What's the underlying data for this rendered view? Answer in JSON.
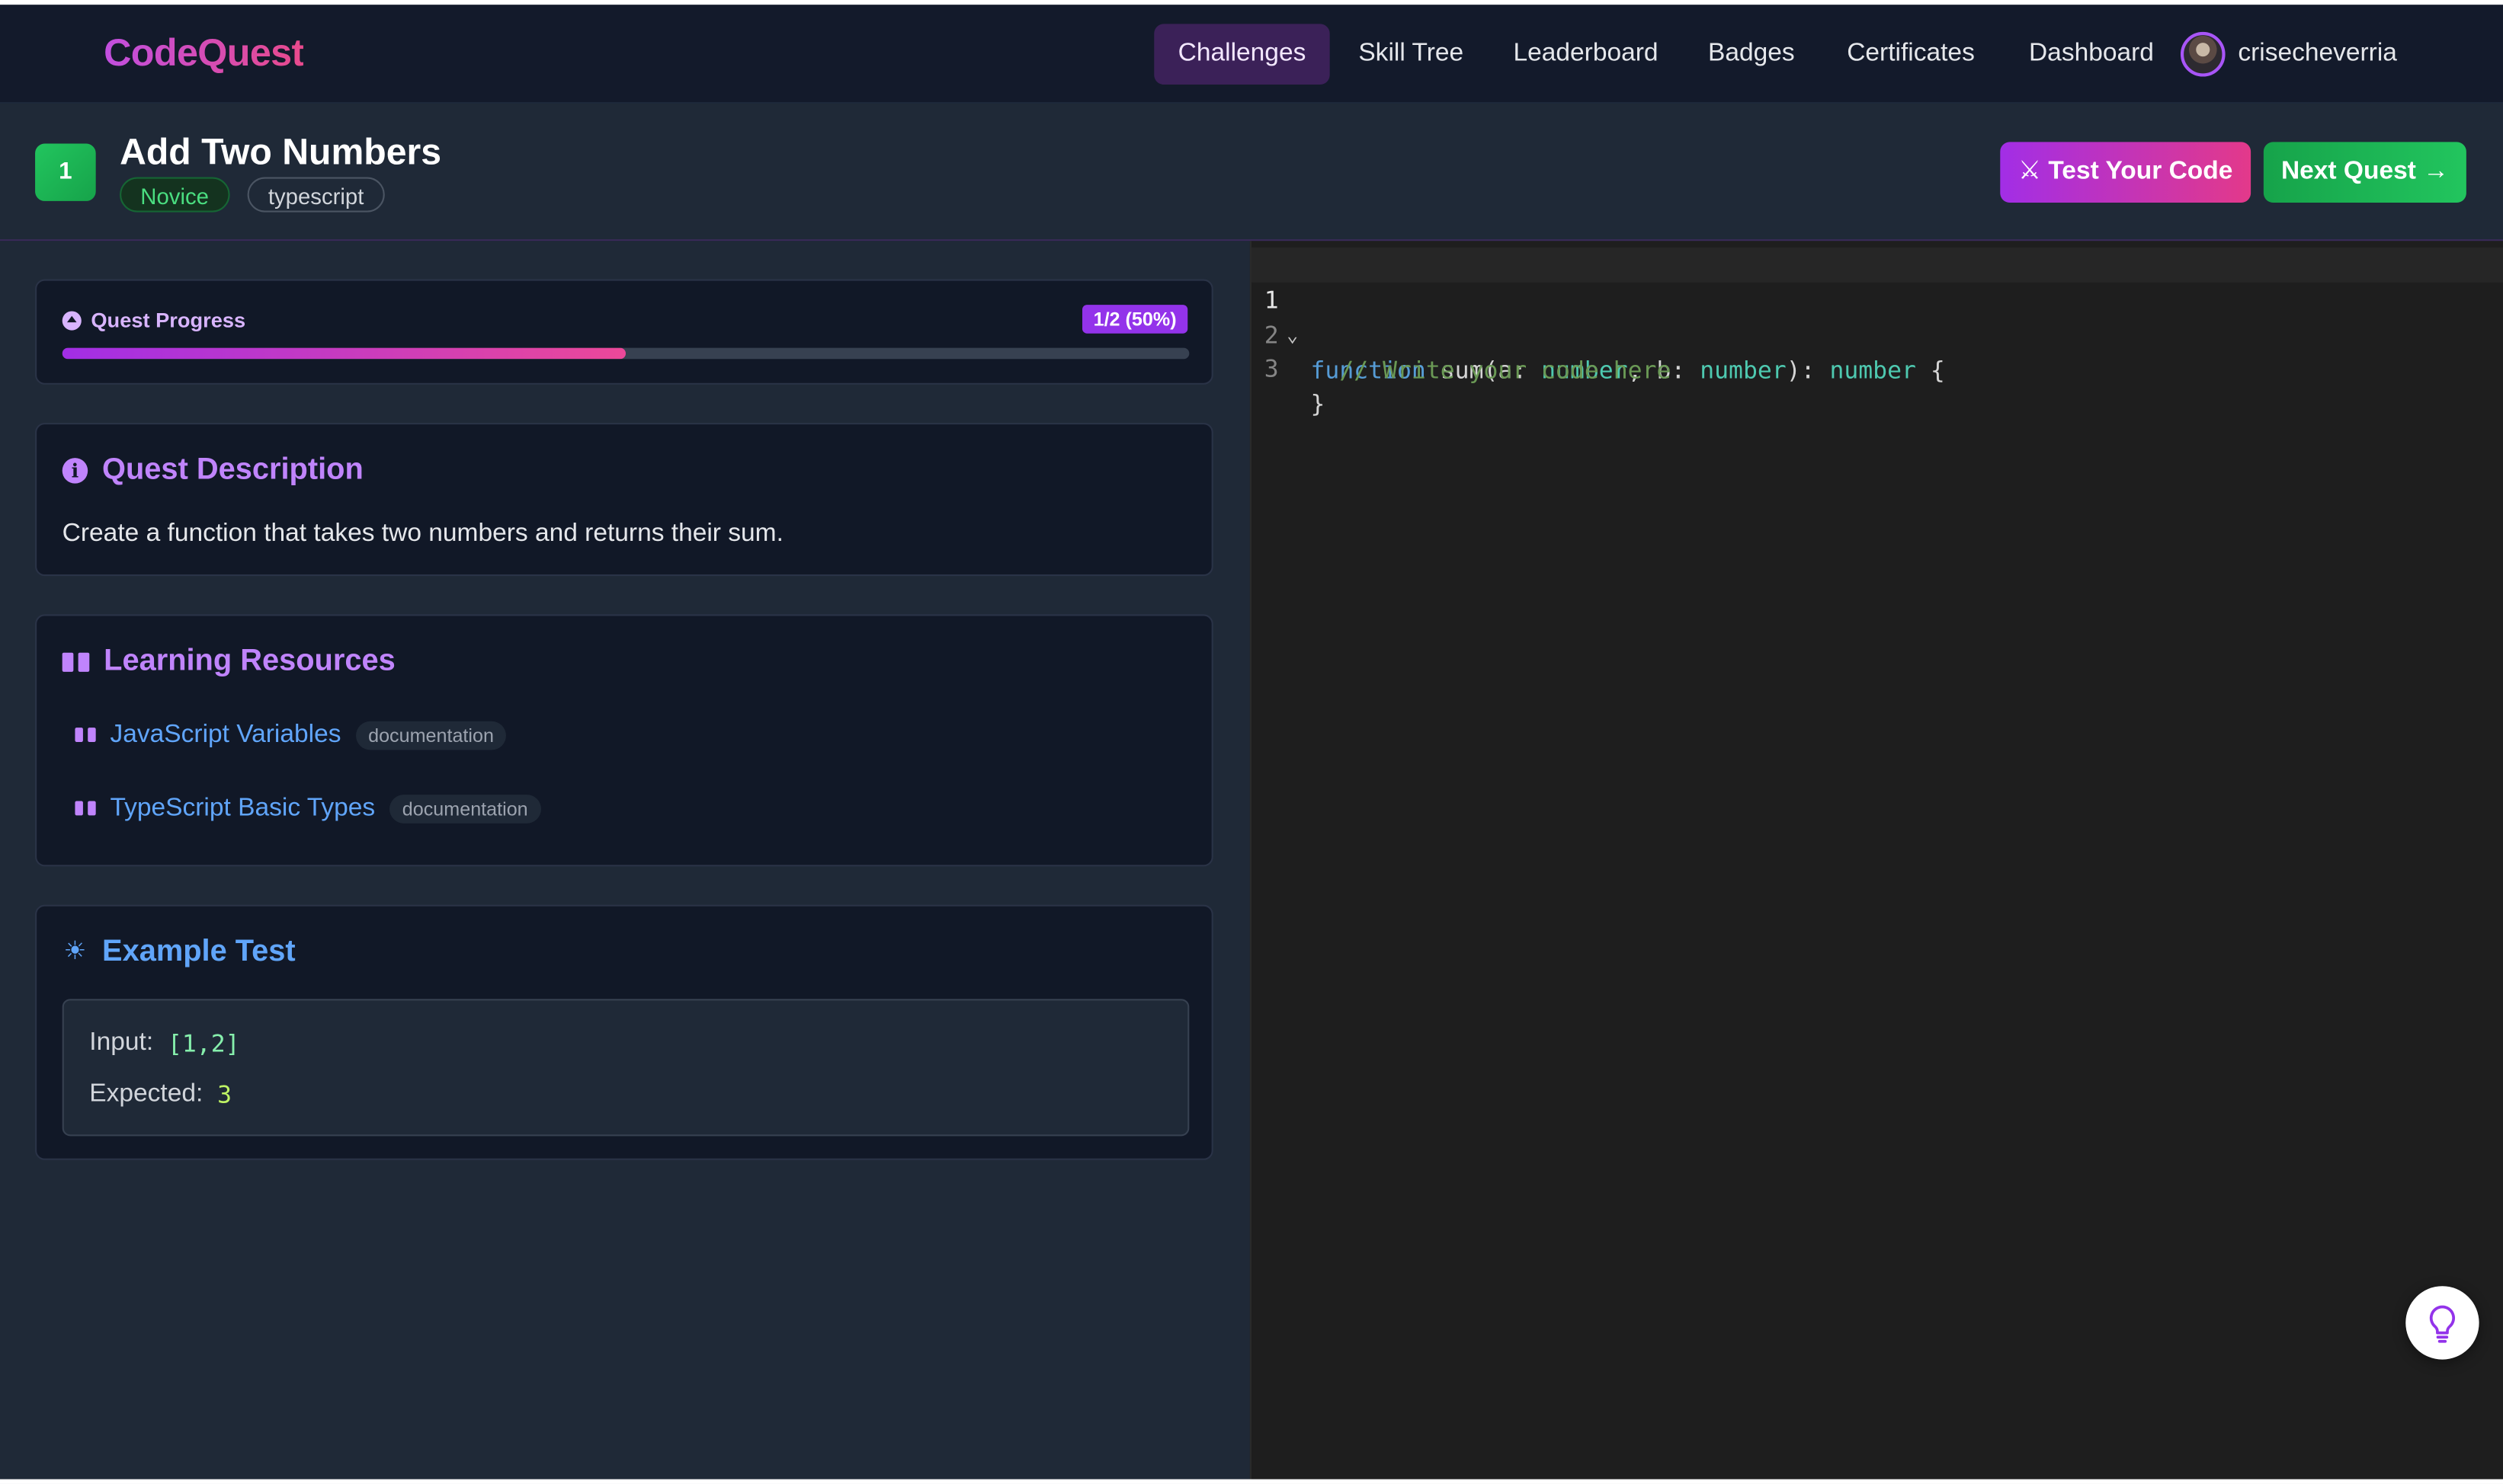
{
  "app": {
    "logo": "CodeQuest"
  },
  "nav": {
    "items": [
      {
        "label": "Challenges",
        "active": true
      },
      {
        "label": "Skill Tree"
      },
      {
        "label": "Leaderboard"
      },
      {
        "label": "Badges"
      },
      {
        "label": "Certificates"
      },
      {
        "label": "Dashboard"
      }
    ],
    "username": "crisecheverria"
  },
  "quest": {
    "number": "1",
    "title": "Add Two Numbers",
    "difficulty": "Novice",
    "language": "typescript",
    "test_button": "⚔ Test Your Code",
    "next_button": "Next Quest →"
  },
  "progress": {
    "label": "Quest Progress",
    "badge": "1/2 (50%)",
    "fraction": 0.5
  },
  "description": {
    "title": "Quest Description",
    "text": "Create a function that takes two numbers and returns their sum."
  },
  "resources": {
    "title": "Learning Resources",
    "items": [
      {
        "label": "JavaScript Variables",
        "type": "documentation"
      },
      {
        "label": "TypeScript Basic Types",
        "type": "documentation"
      }
    ]
  },
  "example": {
    "title": "Example Test",
    "input_label": "Input:",
    "input_value": "[1,2]",
    "expected_label": "Expected:",
    "expected_value": "3"
  },
  "editor": {
    "line_numbers": [
      "1",
      "2",
      "3"
    ],
    "code": {
      "kw_function": "function",
      "sig_name": " sum(a: ",
      "type_a": "number",
      "sig_mid": ", b: ",
      "type_b": "number",
      "sig_close": "): ",
      "type_ret": "number",
      "brace_open": " {",
      "comment": "  // Write your code here",
      "brace_close": "}"
    }
  },
  "colors": {
    "accent_purple": "#a855f7",
    "accent_pink": "#ec4899",
    "accent_green": "#22c55e",
    "link_blue": "#60a5fa"
  },
  "icons": [
    "circle-up-icon",
    "info-icon",
    "book-icon",
    "sun-icon",
    "chevron-down-icon",
    "lightbulb-icon",
    "sword-icon"
  ]
}
